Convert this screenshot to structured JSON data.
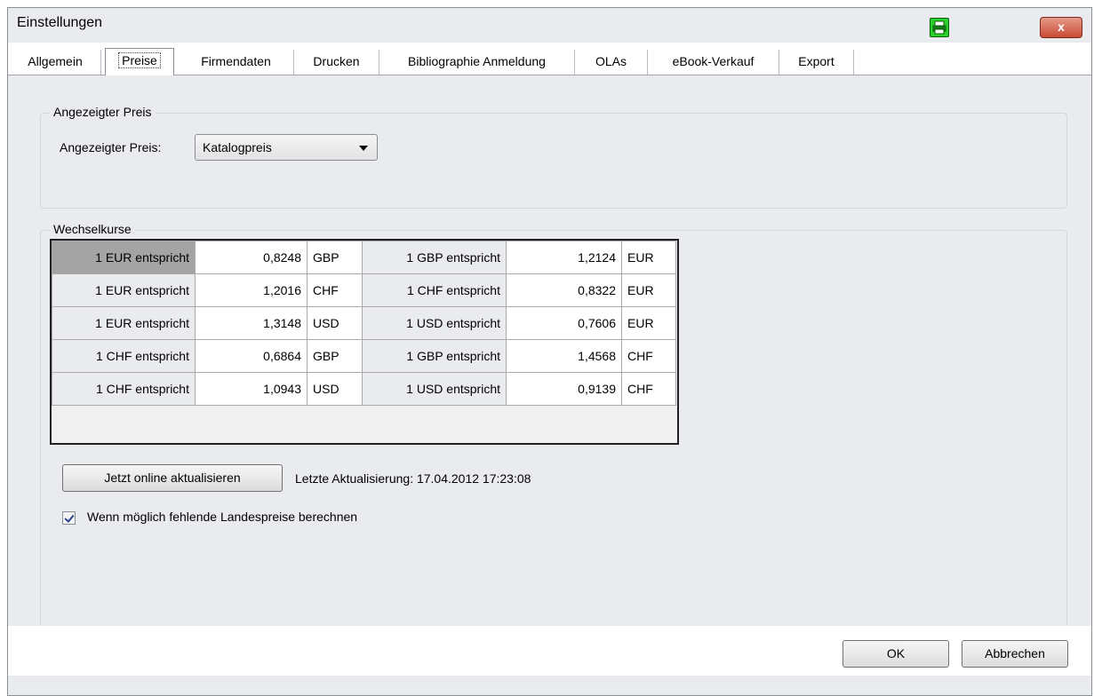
{
  "window": {
    "title": "Einstellungen",
    "close_label": "x"
  },
  "tabs": [
    {
      "label": "Allgemein"
    },
    {
      "label": "Preise",
      "active": true
    },
    {
      "label": "Firmendaten"
    },
    {
      "label": "Drucken"
    },
    {
      "label": "Bibliographie Anmeldung"
    },
    {
      "label": "OLAs"
    },
    {
      "label": "eBook-Verkauf"
    },
    {
      "label": "Export"
    }
  ],
  "price_group": {
    "legend": "Angezeigter Preis",
    "label": "Angezeigter Preis:",
    "selected": "Katalogpreis"
  },
  "rates_group": {
    "legend": "Wechselkurse",
    "rows": [
      {
        "l1": "1 EUR entspricht",
        "v1": "0,8248",
        "c1": "GBP",
        "l2": "1 GBP entspricht",
        "v2": "1,2124",
        "c2": "EUR"
      },
      {
        "l1": "1 EUR entspricht",
        "v1": "1,2016",
        "c1": "CHF",
        "l2": "1 CHF entspricht",
        "v2": "0,8322",
        "c2": "EUR"
      },
      {
        "l1": "1 EUR entspricht",
        "v1": "1,3148",
        "c1": "USD",
        "l2": "1 USD entspricht",
        "v2": "0,7606",
        "c2": "EUR"
      },
      {
        "l1": "1 CHF entspricht",
        "v1": "0,6864",
        "c1": "GBP",
        "l2": "1 GBP entspricht",
        "v2": "1,4568",
        "c2": "CHF"
      },
      {
        "l1": "1 CHF entspricht",
        "v1": "1,0943",
        "c1": "USD",
        "l2": "1 USD entspricht",
        "v2": "0,9139",
        "c2": "CHF"
      }
    ],
    "update_button": "Jetzt online aktualisieren",
    "last_update": "Letzte Aktualisierung: 17.04.2012 17:23:08",
    "checkbox_label": "Wenn möglich fehlende Landespreise berechnen",
    "checkbox_checked": true
  },
  "buttons": {
    "ok": "OK",
    "cancel": "Abbrechen"
  },
  "colors": {
    "accent": "#29d129",
    "close": "#c94a34",
    "window_bg": "#e9ebef"
  }
}
